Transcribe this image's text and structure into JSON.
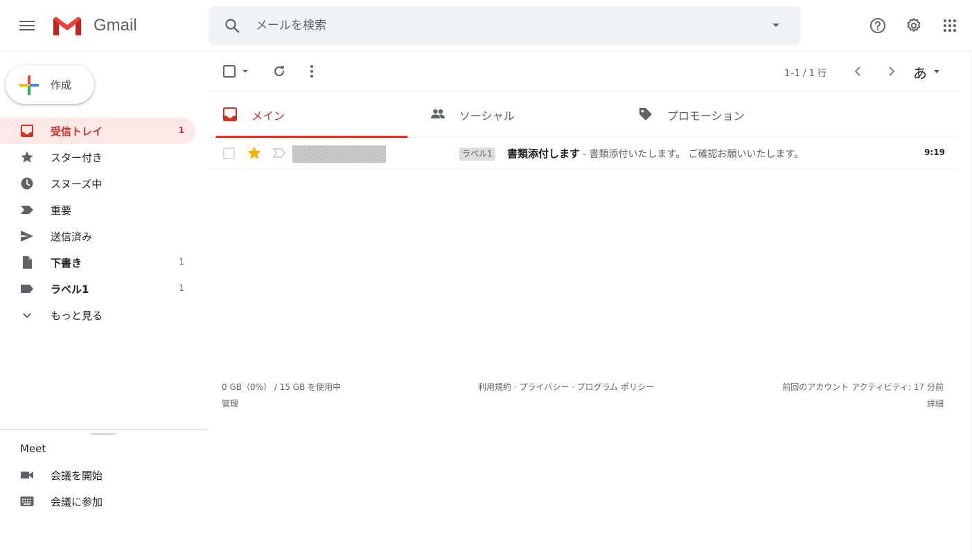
{
  "app": {
    "logo_text": "Gmail",
    "accent_color": "#d93025"
  },
  "search": {
    "placeholder": "メールを検索",
    "value": ""
  },
  "header_icons": [
    "hamburger-icon",
    "help-icon",
    "gear-icon",
    "apps-grid-icon"
  ],
  "compose": {
    "label": "作成"
  },
  "sidebar": {
    "items": [
      {
        "label": "受信トレイ",
        "count": "1",
        "icon": "inbox-icon",
        "active": true
      },
      {
        "label": "スター付き",
        "count": "",
        "icon": "star-icon"
      },
      {
        "label": "スヌーズ中",
        "count": "",
        "icon": "clock-icon"
      },
      {
        "label": "重要",
        "count": "",
        "icon": "important-icon"
      },
      {
        "label": "送信済み",
        "count": "",
        "icon": "send-icon"
      },
      {
        "label": "下書き",
        "count": "1",
        "icon": "draft-icon"
      },
      {
        "label": "ラベル1",
        "count": "1",
        "icon": "label-icon"
      },
      {
        "label": "もっと見る",
        "count": "",
        "icon": "chevron-down-icon"
      }
    ]
  },
  "meet": {
    "title": "Meet",
    "items": [
      {
        "label": "会議を開始",
        "icon": "video-icon"
      },
      {
        "label": "会議に参加",
        "icon": "keyboard-icon"
      }
    ]
  },
  "toolbar": {
    "pagination": "1–1 / 1 行",
    "input_tool": "あ"
  },
  "tabs": [
    {
      "label": "メイン",
      "icon": "inbox-icon",
      "active": true
    },
    {
      "label": "ソーシャル",
      "icon": "people-icon"
    },
    {
      "label": "プロモーション",
      "icon": "tag-icon"
    }
  ],
  "emails": [
    {
      "label_chip": "ラベル1",
      "subject": "書類添付します",
      "snippet": "- 書類添付いたします。 ご確認お願いいたします。",
      "time": "9:19",
      "starred": true
    }
  ],
  "footer": {
    "storage": "0 GB（0%） / 15 GB を使用中",
    "manage": "管理",
    "policies": "利用規約 · プライバシー · プログラム ポリシー",
    "last_activity": "前回のアカウント アクティビティ: 17 分前",
    "details": "詳細"
  }
}
